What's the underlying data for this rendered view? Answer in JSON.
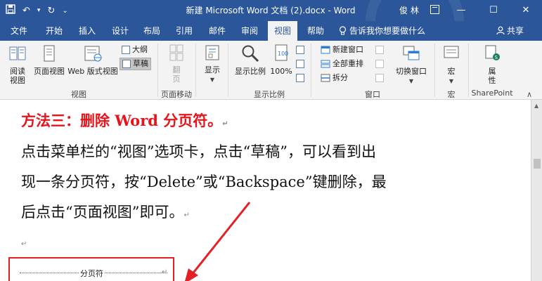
{
  "titlebar": {
    "title": "新建 Microsoft Word 文档 (2).docx  -  Word",
    "user": "俊 林",
    "save_icon": "save-icon",
    "undo_glyph": "↶",
    "undo_menu_glyph": "▾",
    "redo_glyph": "↻",
    "customize_glyph": "⌄",
    "minimize_glyph": "—",
    "maximize_glyph": "☐",
    "close_glyph": "✕"
  },
  "tabs": {
    "items": [
      "文件",
      "开始",
      "插入",
      "设计",
      "布局",
      "引用",
      "邮件",
      "审阅",
      "视图",
      "帮助"
    ],
    "active": "视图",
    "tell_me": "告诉我你想要做什么",
    "share": "共享"
  },
  "ribbon": {
    "views": {
      "read_mode": "阅读\n视图",
      "print_layout": "页面视图",
      "web_layout": "Web 版式视图",
      "outline": "大纲",
      "draft": "草稿",
      "group_label": "视图"
    },
    "page_movement": {
      "vertical": "翻\n页",
      "group_label": "页面移动"
    },
    "show": {
      "show": "显示",
      "group_label": ""
    },
    "zoom": {
      "zoom": "显示比例",
      "hundred": "100%",
      "group_label": "显示比例"
    },
    "window": {
      "new_window": "新建窗口",
      "arrange_all": "全部重排",
      "split": "拆分",
      "switch_windows": "切换窗口",
      "group_label": "窗口"
    },
    "macros": {
      "macros": "宏",
      "group_label": "宏"
    },
    "sharepoint": {
      "properties": "属\n性",
      "group_label": "SharePoint"
    },
    "collapse_glyph": "∧"
  },
  "document": {
    "heading": "方法三：删除 Word 分页符。",
    "line1": "点击菜单栏的“视图”选项卡，点击“草稿”，可以看到出",
    "line2": "现一条分页符，按“Delete”或“Backspace”键删除，最",
    "line3": "后点击“页面视图”即可。",
    "return_mark": "↵",
    "page_break_label": "分页符"
  },
  "colors": {
    "word_blue": "#2b579a",
    "heading_red": "#e8141b",
    "annotation_red": "#e41f26"
  }
}
